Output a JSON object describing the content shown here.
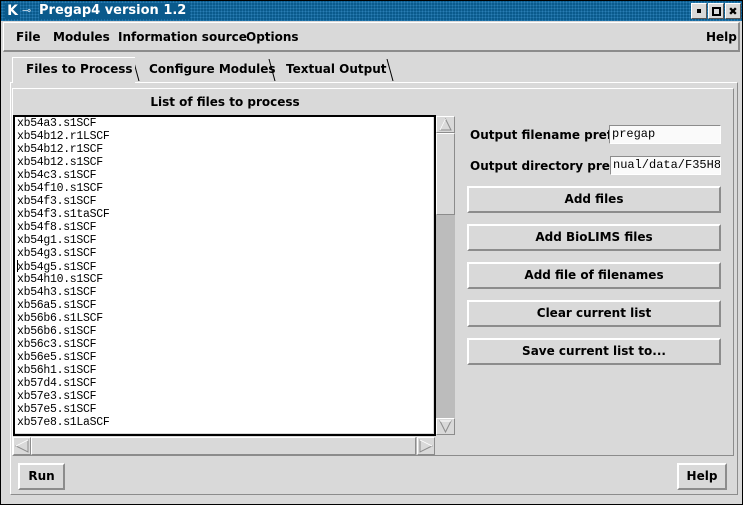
{
  "window": {
    "title": "Pregap4 version 1.2",
    "app_icon": "kde-k-icon",
    "pin_icon": "pin-icon",
    "controls": {
      "minimize": "minimize-icon",
      "maximize": "maximize-icon",
      "close": "close-icon",
      "close_glyph": "✖"
    }
  },
  "menubar": {
    "items": [
      "File",
      "Modules",
      "Information source",
      "Options"
    ],
    "help": "Help"
  },
  "tabs": [
    {
      "label": "Files to Process",
      "active": true
    },
    {
      "label": "Configure Modules",
      "active": false
    },
    {
      "label": "Textual Output",
      "active": false
    }
  ],
  "file_list": {
    "heading": "List of files to process",
    "items": [
      "xb54a3.s1SCF",
      "xb54b12.r1LSCF",
      "xb54b12.r1SCF",
      "xb54b12.s1SCF",
      "xb54c3.s1SCF",
      "xb54f10.s1SCF",
      "xb54f3.s1SCF",
      "xb54f3.s1taSCF",
      "xb54f8.s1SCF",
      "xb54g1.s1SCF",
      "xb54g3.s1SCF",
      "xb54g5.s1SCF",
      "xb54h10.s1SCF",
      "xb54h3.s1SCF",
      "xb56a5.s1SCF",
      "xb56b6.s1LSCF",
      "xb56b6.s1SCF",
      "xb56c3.s1SCF",
      "xb56e5.s1SCF",
      "xb56h1.s1SCF",
      "xb57d4.s1SCF",
      "xb57e3.s1SCF",
      "xb57e5.s1SCF",
      "xb57e8.s1LaSCF"
    ],
    "cursor_row": 11
  },
  "form": {
    "filename_prefix_label": "Output filename prefix",
    "filename_prefix_value": "pregap",
    "directory_prefix_label": "Output directory prefix",
    "directory_prefix_value": "nual/data/F35H8"
  },
  "buttons": {
    "add_files": "Add files",
    "add_biolims": "Add BioLIMS files",
    "add_file_of_filenames": "Add file of filenames",
    "clear_list": "Clear current list",
    "save_list": "Save current list to...",
    "run": "Run",
    "help": "Help"
  }
}
